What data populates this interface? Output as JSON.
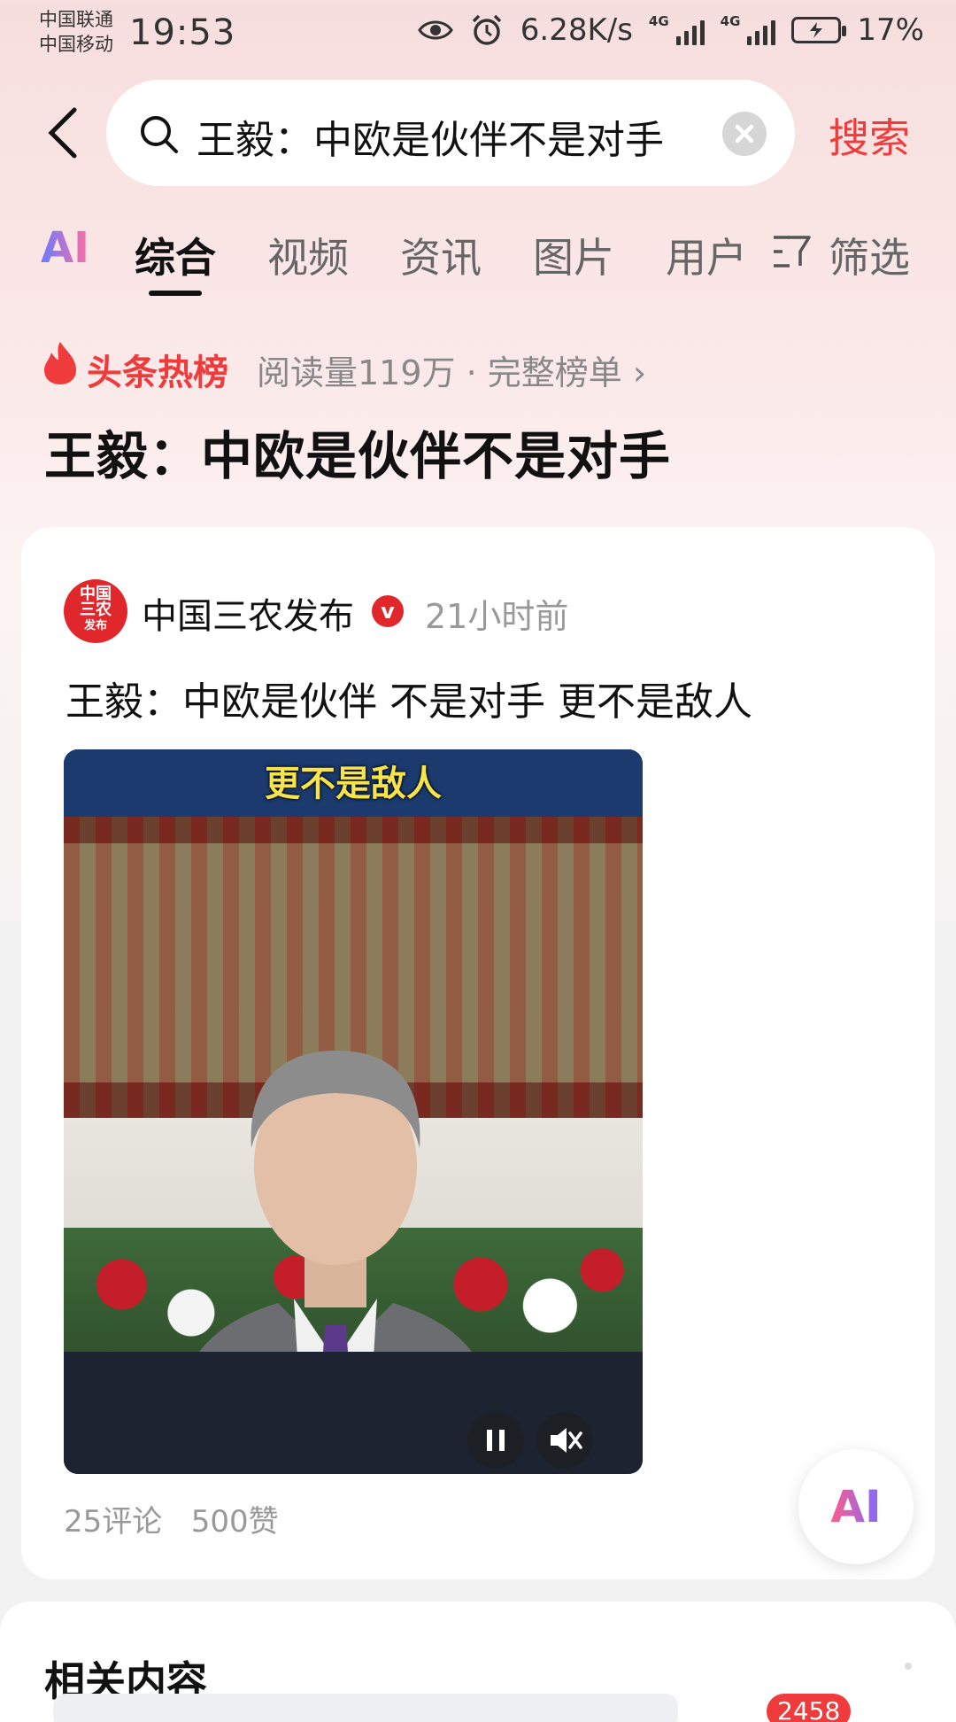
{
  "status_bar": {
    "carrier_1": "中国联通",
    "carrier_2": "中国移动",
    "time": "19:53",
    "net_speed": "6.28K/s",
    "signal_label_1": "4G",
    "signal_label_2": "4G",
    "battery": "17%"
  },
  "search": {
    "query": "王毅：中欧是伙伴不是对手",
    "search_button": "搜索"
  },
  "tabs": {
    "ai": "AI",
    "items": [
      "综合",
      "视频",
      "资讯",
      "图片",
      "用户"
    ],
    "active": "综合",
    "filter": "筛选"
  },
  "hot_list": {
    "label": "头条热榜",
    "meta": "阅读量119万 · 完整榜单 ›"
  },
  "page_title": "王毅：中欧是伙伴不是对手",
  "post": {
    "avatar_text": [
      "中国",
      "三农",
      "发布"
    ],
    "author": "中国三农发布",
    "verified": "v",
    "time": "21小时前",
    "title": "王毅：中欧是伙伴 不是对手 更不是敌人",
    "video_caption": "更不是敌人",
    "comments": "25评论",
    "likes": "500赞"
  },
  "ai_button": "AI",
  "related": {
    "title": "相关内容",
    "badge": "2458"
  },
  "colors": {
    "accent": "#ef3b3b",
    "background_top": "#f7dede",
    "card": "#ffffff"
  }
}
